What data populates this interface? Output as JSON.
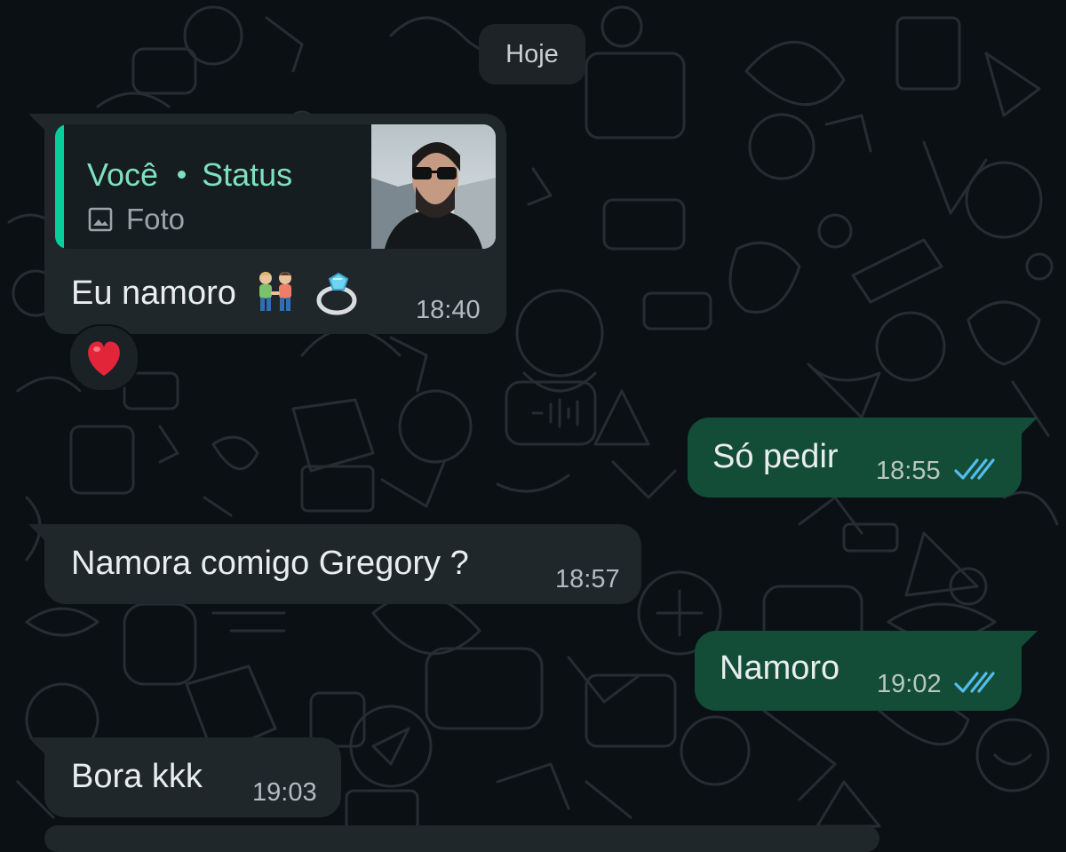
{
  "date_label": "Hoje",
  "messages": [
    {
      "direction": "incoming",
      "quote": {
        "author": "Você",
        "context": "Status",
        "media_type": "Foto",
        "media_icon": "image-icon"
      },
      "text": "Eu namoro",
      "emojis": [
        "men-holding-hands-emoji",
        "ring-emoji"
      ],
      "time": "18:40",
      "reaction": "heart-emoji"
    },
    {
      "direction": "outgoing",
      "text": "Só pedir",
      "time": "18:55",
      "status_icon": "double-check-read-icon"
    },
    {
      "direction": "incoming",
      "text": "Namora comigo Gregory ?",
      "time": "18:57"
    },
    {
      "direction": "outgoing",
      "text": "Namoro",
      "time": "19:02",
      "status_icon": "double-check-read-icon"
    },
    {
      "direction": "incoming",
      "text": "Bora kkk",
      "time": "19:03"
    }
  ],
  "colors": {
    "background": "#0b1014",
    "incoming_bubble": "#1f272b",
    "outgoing_bubble": "#144d37",
    "quote_accent": "#06cf9c",
    "quote_author": "#7fe0bd",
    "read_ticks": "#53bdeb",
    "reaction_heart": "#e3253a"
  }
}
